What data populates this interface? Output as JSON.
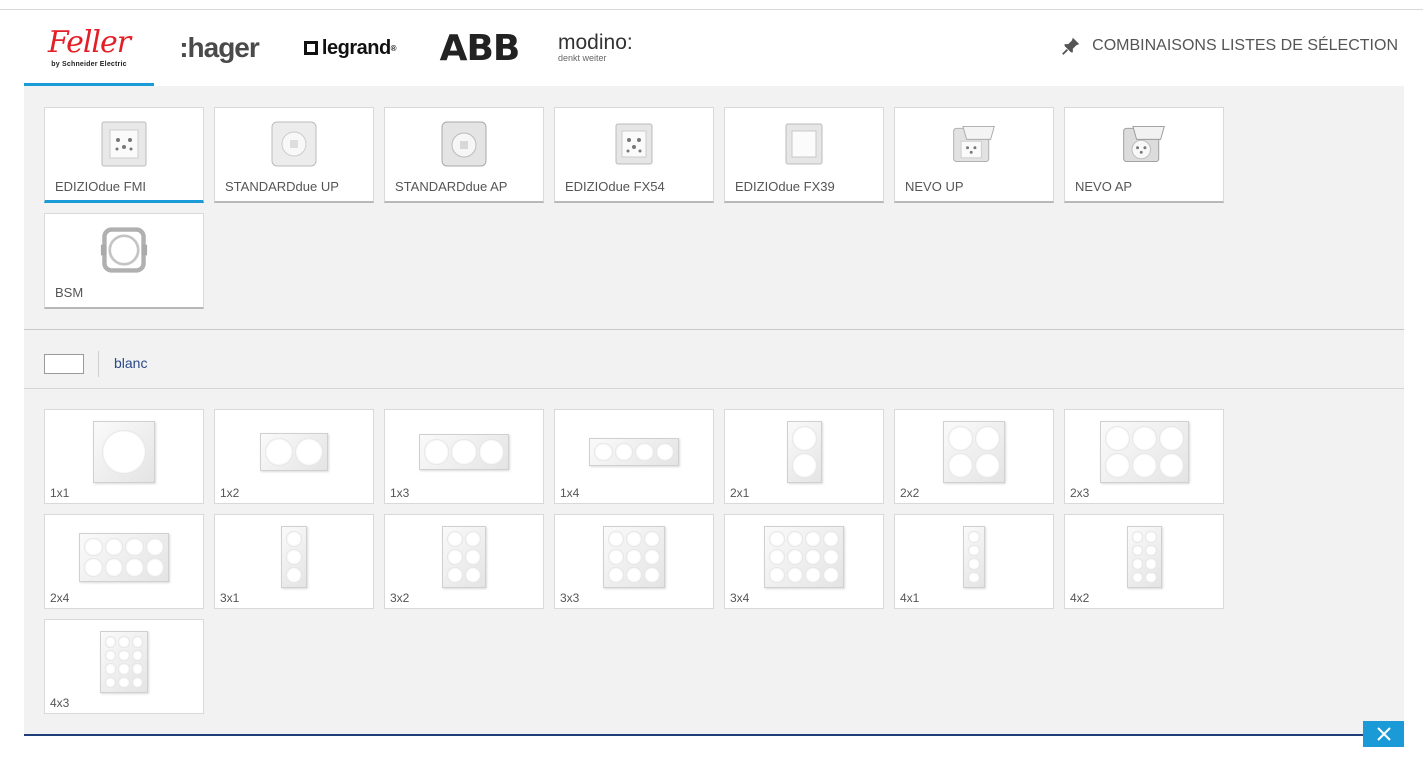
{
  "brands": [
    {
      "name": "Feller",
      "sub": "by Schneider Electric",
      "active": true
    },
    {
      "name": ":hager"
    },
    {
      "name": "legrand",
      "mark": "®"
    },
    {
      "name": "ABB"
    },
    {
      "name": "modino:",
      "sub": "denkt weiter"
    }
  ],
  "header": {
    "combo_label": "COMBINAISONS LISTES DE SÉLECTION",
    "icon": "pin-icon"
  },
  "products": [
    {
      "label": "EDIZIOdue FMI",
      "active": true
    },
    {
      "label": "STANDARDdue UP"
    },
    {
      "label": "STANDARDdue AP"
    },
    {
      "label": "EDIZIOdue FX54"
    },
    {
      "label": "EDIZIOdue FX39"
    },
    {
      "label": "NEVO UP"
    },
    {
      "label": "NEVO AP"
    },
    {
      "label": "BSM"
    }
  ],
  "color": {
    "swatch": "#ffffff",
    "name": "blanc"
  },
  "frames": [
    {
      "label": "1x1"
    },
    {
      "label": "1x2"
    },
    {
      "label": "1x3"
    },
    {
      "label": "1x4"
    },
    {
      "label": "2x1"
    },
    {
      "label": "2x2"
    },
    {
      "label": "2x3"
    },
    {
      "label": "2x4"
    },
    {
      "label": "3x1"
    },
    {
      "label": "3x2"
    },
    {
      "label": "3x3"
    },
    {
      "label": "3x4"
    },
    {
      "label": "4x1"
    },
    {
      "label": "4x2"
    },
    {
      "label": "4x3"
    }
  ],
  "close_icon": "close-icon",
  "accent": "#1a9ad6",
  "brand_red": "#e41e26"
}
